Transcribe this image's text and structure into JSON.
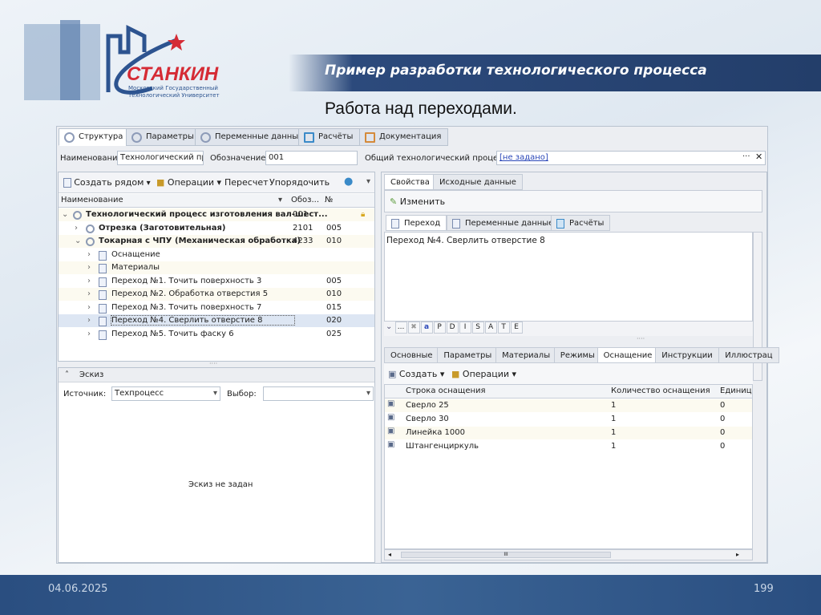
{
  "slide": {
    "title": "Пример разработки технологического процесса",
    "subtitle": "Работа над переходами.",
    "date": "04.06.2025",
    "page": "199",
    "logo": {
      "name": "СТАНКИН",
      "line1": "Московский Государственный",
      "line2": "Технологический Университет"
    }
  },
  "app": {
    "main_tabs": [
      {
        "label": "Структура",
        "icon": "gear-icon"
      },
      {
        "label": "Параметры",
        "icon": "gear-icon"
      },
      {
        "label": "Переменные данные",
        "icon": "gear-icon"
      },
      {
        "label": "Расчёты",
        "icon": "calculator-icon"
      },
      {
        "label": "Документация",
        "icon": "document-icon"
      }
    ],
    "fields": {
      "name_label": "Наименование",
      "name_value": "Технологический про",
      "code_label": "Обозначение",
      "code_value": "001",
      "common_label": "Общий технологический процесс",
      "common_value": "[не задано]"
    },
    "tree_toolbar": {
      "create": "Создать рядом",
      "operations": "Операции",
      "recalc": "Пересчет",
      "order": "Упорядочить"
    },
    "tree_columns": [
      "Наименование",
      "Обоз...",
      "№"
    ],
    "tree": [
      {
        "label": "Технологический процесс изготовления вал-шест...",
        "code": "001",
        "num": "",
        "level": 0,
        "expanded": true,
        "icon": "gear"
      },
      {
        "label": "Отрезка (Заготовительная)",
        "code": "2101",
        "num": "005",
        "level": 1,
        "expanded": false,
        "icon": "gears"
      },
      {
        "label": "Токарная с ЧПУ (Механическая обработка)",
        "code": "4233",
        "num": "010",
        "level": 1,
        "expanded": true,
        "icon": "gears"
      },
      {
        "label": "Оснащение",
        "code": "",
        "num": "",
        "level": 2,
        "icon": "equipment"
      },
      {
        "label": "Материалы",
        "code": "",
        "num": "",
        "level": 2,
        "icon": "materials"
      },
      {
        "label": "Переход №1. Точить поверхность 3",
        "code": "",
        "num": "005",
        "level": 2,
        "icon": "doc"
      },
      {
        "label": "Переход №2. Обработка отверстия 5",
        "code": "",
        "num": "010",
        "level": 2,
        "icon": "doc"
      },
      {
        "label": "Переход №3. Точить поверхность 7",
        "code": "",
        "num": "015",
        "level": 2,
        "icon": "doc"
      },
      {
        "label": "Переход №4. Сверлить отверстие 8",
        "code": "",
        "num": "020",
        "level": 2,
        "icon": "doc",
        "selected": true
      },
      {
        "label": "Переход №5. Точить фаску 6",
        "code": "",
        "num": "025",
        "level": 2,
        "icon": "doc"
      }
    ],
    "sketch": {
      "title": "Эскиз",
      "source_label": "Источник:",
      "source_value": "Техпроцесс",
      "choice_label": "Выбор:",
      "choice_value": "",
      "empty": "Эскиз не задан"
    },
    "right_tabs": [
      "Свойства",
      "Исходные данные"
    ],
    "edit_button": "Изменить",
    "inner_tabs": [
      "Переход",
      "Переменные данные",
      "Расчёты"
    ],
    "step_text": "Переход №4. Сверлить отверстие 8",
    "format_buttons": [
      "...",
      "P",
      "D",
      "I",
      "S",
      "A",
      "T",
      "E"
    ],
    "bottom_tabs": [
      "Основные",
      "Параметры",
      "Материалы",
      "Режимы",
      "Оснащение",
      "Инструкции",
      "Иллюстрац"
    ],
    "bottom_active": "Оснащение",
    "equip_toolbar": {
      "create": "Создать",
      "operations": "Операции"
    },
    "equip_columns": [
      "Строка оснащения",
      "Количество оснащения",
      "Единиц"
    ],
    "equip_rows": [
      [
        "Сверло 25",
        "1",
        "0"
      ],
      [
        "Сверло 30",
        "1",
        "0"
      ],
      [
        "Линейка 1000",
        "1",
        "0"
      ],
      [
        "Штангенциркуль",
        "1",
        "0"
      ]
    ],
    "scroll_label": "III"
  }
}
